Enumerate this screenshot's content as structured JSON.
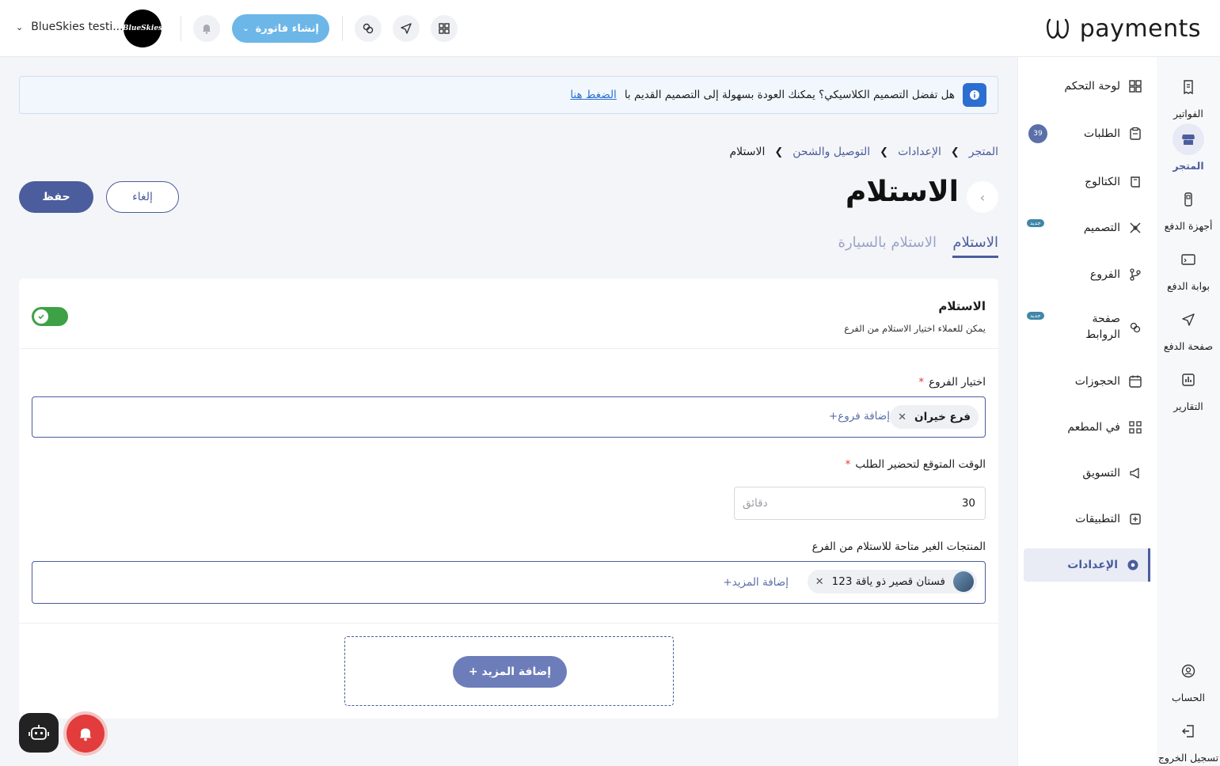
{
  "topbar": {
    "brand": "payments",
    "create_invoice": "إنشاء فاتورة",
    "account_name": "BlueSkies testi...",
    "avatar_text": "BlueSkies"
  },
  "banner": {
    "text": "هل تفضل التصميم الكلاسيكي؟ يمكنك العودة بسهولة إلى التصميم القديم با",
    "link": "الضغط هنا"
  },
  "breadcrumb": [
    "المتجر",
    "الإعدادات",
    "التوصيل والشحن",
    "الاستلام"
  ],
  "page": {
    "title": "الاستلام",
    "save": "حفظ",
    "cancel": "إلغاء",
    "tabs": [
      "الاستلام",
      "الاستلام بالسيارة"
    ]
  },
  "pickup": {
    "title": "الاستلام",
    "subtitle": "يمكن للعملاء اختيار الاستلام من الفرع",
    "enabled": true,
    "branches_label": "اختيار الفروع",
    "branch_chip": "فرع خيران",
    "add_branches": "+إضافة فروع",
    "prep_label": "الوقت المتوقع لتحضير الطلب",
    "prep_value": "30",
    "prep_unit": "دقائق",
    "unavailable_label": "المنتجات الغير متاحة للاستلام من الفرع",
    "product_chip": "فستان قصير ذو ياقة 123",
    "add_more_link": "+إضافة المزيد",
    "add_more_button": "+ إضافة المزيد"
  },
  "rail": [
    {
      "label": "الفواتير",
      "icon": "invoice-icon"
    },
    {
      "label": "المتجر",
      "icon": "store-icon",
      "active": true
    },
    {
      "label": "أجهزة الدفع",
      "icon": "pos-device-icon"
    },
    {
      "label": "بوابة الدفع",
      "icon": "gateway-icon"
    },
    {
      "label": "صفحة الدفع",
      "icon": "send-icon"
    },
    {
      "label": "التقارير",
      "icon": "reports-icon"
    },
    {
      "label": "الحساب",
      "icon": "account-icon"
    },
    {
      "label": "تسجيل الخروج",
      "icon": "logout-icon"
    }
  ],
  "menu": [
    {
      "label": "لوحة التحكم",
      "icon": "dashboard-icon"
    },
    {
      "label": "الطلبات",
      "icon": "orders-icon",
      "count": "39"
    },
    {
      "label": "الكتالوج",
      "icon": "catalog-icon"
    },
    {
      "label": "التصميم",
      "icon": "design-icon",
      "tag": "جديد"
    },
    {
      "label": "الفروع",
      "icon": "branches-icon"
    },
    {
      "label": "صفحة الروابط",
      "icon": "links-icon",
      "tag": "جديد"
    },
    {
      "label": "الحجوزات",
      "icon": "calendar-icon"
    },
    {
      "label": "في المطعم",
      "icon": "qr-icon"
    },
    {
      "label": "التسويق",
      "icon": "megaphone-icon"
    },
    {
      "label": "التطبيقات",
      "icon": "apps-icon"
    },
    {
      "label": "الإعدادات",
      "icon": "settings-icon",
      "active": true
    }
  ],
  "colors": {
    "primary": "#4b5d9c",
    "accent": "#6db6e8",
    "toggle_on": "#3ea146",
    "alert": "#e23c3c"
  }
}
